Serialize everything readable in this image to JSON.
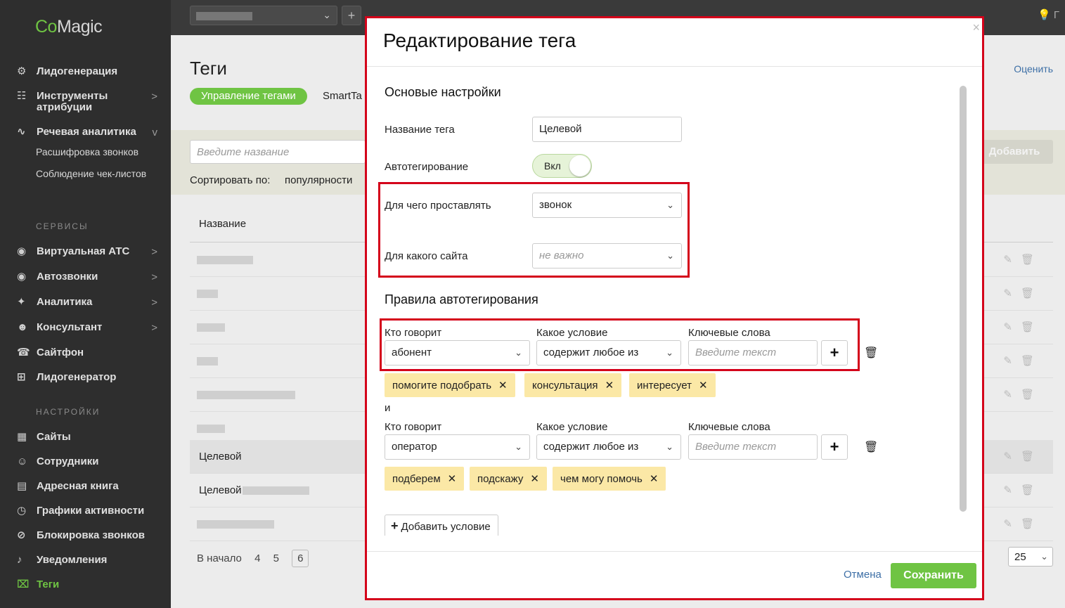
{
  "app": {
    "logo_prefix": "Co",
    "logo_suffix": "Magic",
    "top_right": "Г"
  },
  "sidebar": {
    "items": [
      {
        "icon": "⚙",
        "label": "Лидогенерация",
        "arrow": ""
      },
      {
        "icon": "☷",
        "label": "Инструменты атрибуции",
        "arrow": ">"
      },
      {
        "icon": "∿",
        "label": "Речевая аналитика",
        "arrow": "v"
      }
    ],
    "subitems": [
      "Расшифровка звонков",
      "Соблюдение чек-листов"
    ],
    "section_services": "СЕРВИСЫ",
    "services": [
      {
        "icon": "◉",
        "label": "Виртуальная АТС",
        "arrow": ">"
      },
      {
        "icon": "◉",
        "label": "Автозвонки",
        "arrow": ">"
      },
      {
        "icon": "✦",
        "label": "Аналитика",
        "arrow": ">"
      },
      {
        "icon": "☻",
        "label": "Консультант",
        "arrow": ">"
      },
      {
        "icon": "☎",
        "label": "Сайтфон",
        "arrow": ""
      },
      {
        "icon": "⊞",
        "label": "Лидогенератор",
        "arrow": ""
      }
    ],
    "section_settings": "НАСТРОЙКИ",
    "settings": [
      {
        "icon": "▦",
        "label": "Сайты"
      },
      {
        "icon": "☺",
        "label": "Сотрудники"
      },
      {
        "icon": "▤",
        "label": "Адресная книга"
      },
      {
        "icon": "◷",
        "label": "Графики активности"
      },
      {
        "icon": "⊘",
        "label": "Блокировка звонков"
      },
      {
        "icon": "♪",
        "label": "Уведомления"
      },
      {
        "icon": "⌧",
        "label": "Теги"
      }
    ]
  },
  "page": {
    "title": "Теги",
    "tab_active": "Управление тегами",
    "tab_2": "SmartTa",
    "rate_link": "Оценить",
    "search_placeholder": "Введите название",
    "add_button": "Добавить",
    "sort_label": "Сортировать по:",
    "sort_value": "популярности",
    "col_name": "Название",
    "rows": [
      "",
      "",
      "",
      "",
      "",
      "",
      "Целевой",
      "Целевой",
      ""
    ],
    "pager": {
      "first": "В начало",
      "p4": "4",
      "p5": "5",
      "p6": "6"
    },
    "per_page": "25"
  },
  "modal": {
    "title": "Редактирование тега",
    "section_basic": "Основые настройки",
    "name_label": "Название тега",
    "name_value": "Целевой",
    "autotag_label": "Автотегирование",
    "autotag_toggle": "Вкл",
    "for_what_label": "Для чего проставлять",
    "for_what_value": "звонок",
    "for_site_label": "Для какого сайта",
    "for_site_value": "не важно",
    "section_rules": "Правила автотегирования",
    "rules": [
      {
        "who_label": "Кто говорит",
        "who_value": "абонент",
        "cond_label": "Какое условие",
        "cond_value": "содержит любое из",
        "kw_label": "Ключевые слова",
        "kw_placeholder": "Введите текст",
        "chips": [
          "помогите подобрать",
          "консультация",
          "интересует"
        ]
      },
      {
        "who_label": "Кто говорит",
        "who_value": "оператор",
        "cond_label": "Какое условие",
        "cond_value": "содержит любое из",
        "kw_label": "Ключевые слова",
        "kw_placeholder": "Введите текст",
        "chips": [
          "подберем",
          "подскажу",
          "чем могу помочь"
        ]
      }
    ],
    "and_label": "и",
    "add_condition": "Добавить условие",
    "cancel": "Отмена",
    "save": "Сохранить",
    "close": "×"
  },
  "colors": {
    "accent": "#6fc443",
    "highlight_box": "#d4001a",
    "chip": "#fbe8a6",
    "link": "#3d6fa6"
  }
}
